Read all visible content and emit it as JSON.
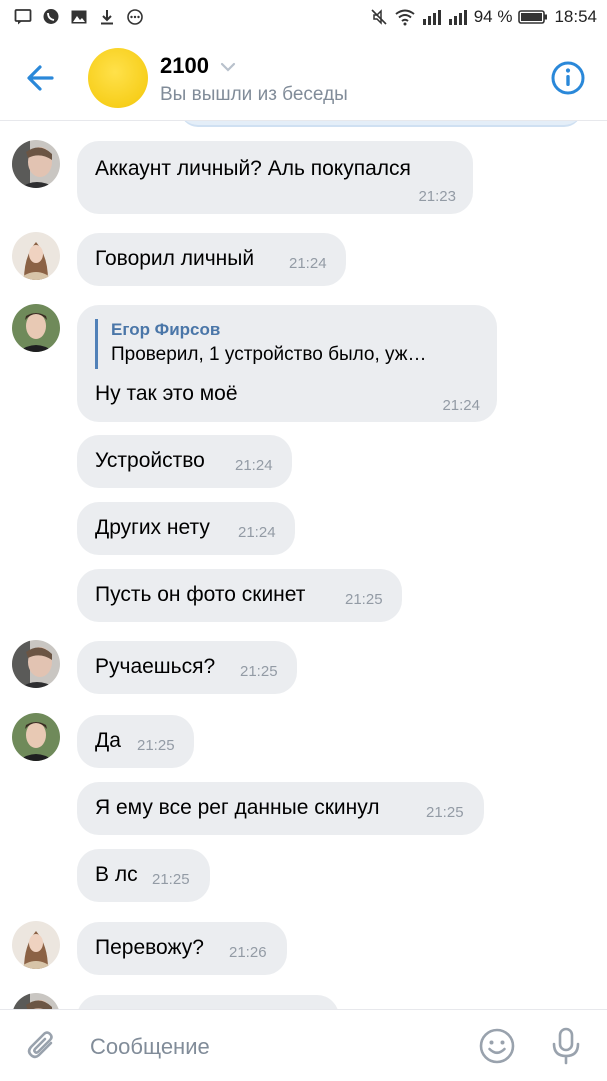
{
  "status_bar": {
    "battery": "94 %",
    "time": "18:54",
    "icons": [
      "message-icon",
      "viber-icon",
      "gallery-icon",
      "download-icon",
      "more-icon",
      "mute-icon",
      "wifi-icon",
      "signal-icon",
      "signal-icon",
      "battery-icon"
    ]
  },
  "header": {
    "title": "2100",
    "subtitle": "Вы вышли из беседы",
    "back_icon": "arrow-left-icon",
    "info_icon": "info-icon",
    "accent_color": "#2a88d9"
  },
  "messages": [
    {
      "avatar": "user-a",
      "text": "Аккаунт личный? Аль покупался",
      "time": "21:23"
    },
    {
      "avatar": "user-b",
      "text": "Говорил личный",
      "time": "21:24"
    },
    {
      "avatar": "user-c",
      "reply_author": "Егор Фирсов",
      "reply_text": "Проверил, 1 устройство было, уж…",
      "text": "Ну так это моё",
      "time": "21:24"
    },
    {
      "avatar": "",
      "text": "Устройство",
      "time": "21:24"
    },
    {
      "avatar": "",
      "text": "Других нету",
      "time": "21:24"
    },
    {
      "avatar": "",
      "text": "Пусть он фото скинет",
      "time": "21:25"
    },
    {
      "avatar": "user-a",
      "text": "Ручаешься?",
      "time": "21:25"
    },
    {
      "avatar": "user-c",
      "text": "Да",
      "time": "21:25"
    },
    {
      "avatar": "",
      "text": "Я ему все рег данные скинул",
      "time": "21:25"
    },
    {
      "avatar": "",
      "text": "В лс",
      "time": "21:25"
    },
    {
      "avatar": "user-b",
      "text": "Перевожу?",
      "time": "21:26"
    }
  ],
  "composer": {
    "placeholder": "Сообщение",
    "attach_icon": "paperclip-icon",
    "emoji_icon": "smile-icon",
    "mic_icon": "microphone-icon"
  },
  "colors": {
    "bubble": "#ebedf0",
    "time": "#939ba5",
    "reply_author": "#4a76a8",
    "subtitle": "#818c99"
  }
}
